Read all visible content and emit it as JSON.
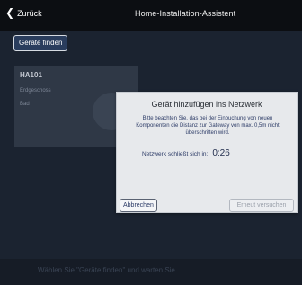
{
  "header": {
    "back_label": "Zurück",
    "title": "Home-Installation-Assistent"
  },
  "toolbar": {
    "find_label": "Geräte finden"
  },
  "device": {
    "name": "HA101",
    "floor": "Erdgeschoss",
    "room": "Bad"
  },
  "dialog": {
    "title": "Gerät hinzufügen ins Netzwerk",
    "body": "Bitte beachten Sie, das bei der Einbuchung von neuen Komponenten die Distanz zur Gateway von max. 0,5m nicht überschritten wird.",
    "timer_label": "Netzwerk schließt sich in:",
    "timer_value": "0:26",
    "cancel_label": "Abbrechen",
    "retry_label": "Erneut versuchen"
  },
  "hint": {
    "line1": "Wählen Sie \"Geräte finden\" und warten Sie",
    "line2": ""
  },
  "colors": {
    "topbar": "#0c0e12",
    "background": "#1b2330",
    "dialog": "#e7e9ec",
    "accent": "#2a3d5d"
  }
}
